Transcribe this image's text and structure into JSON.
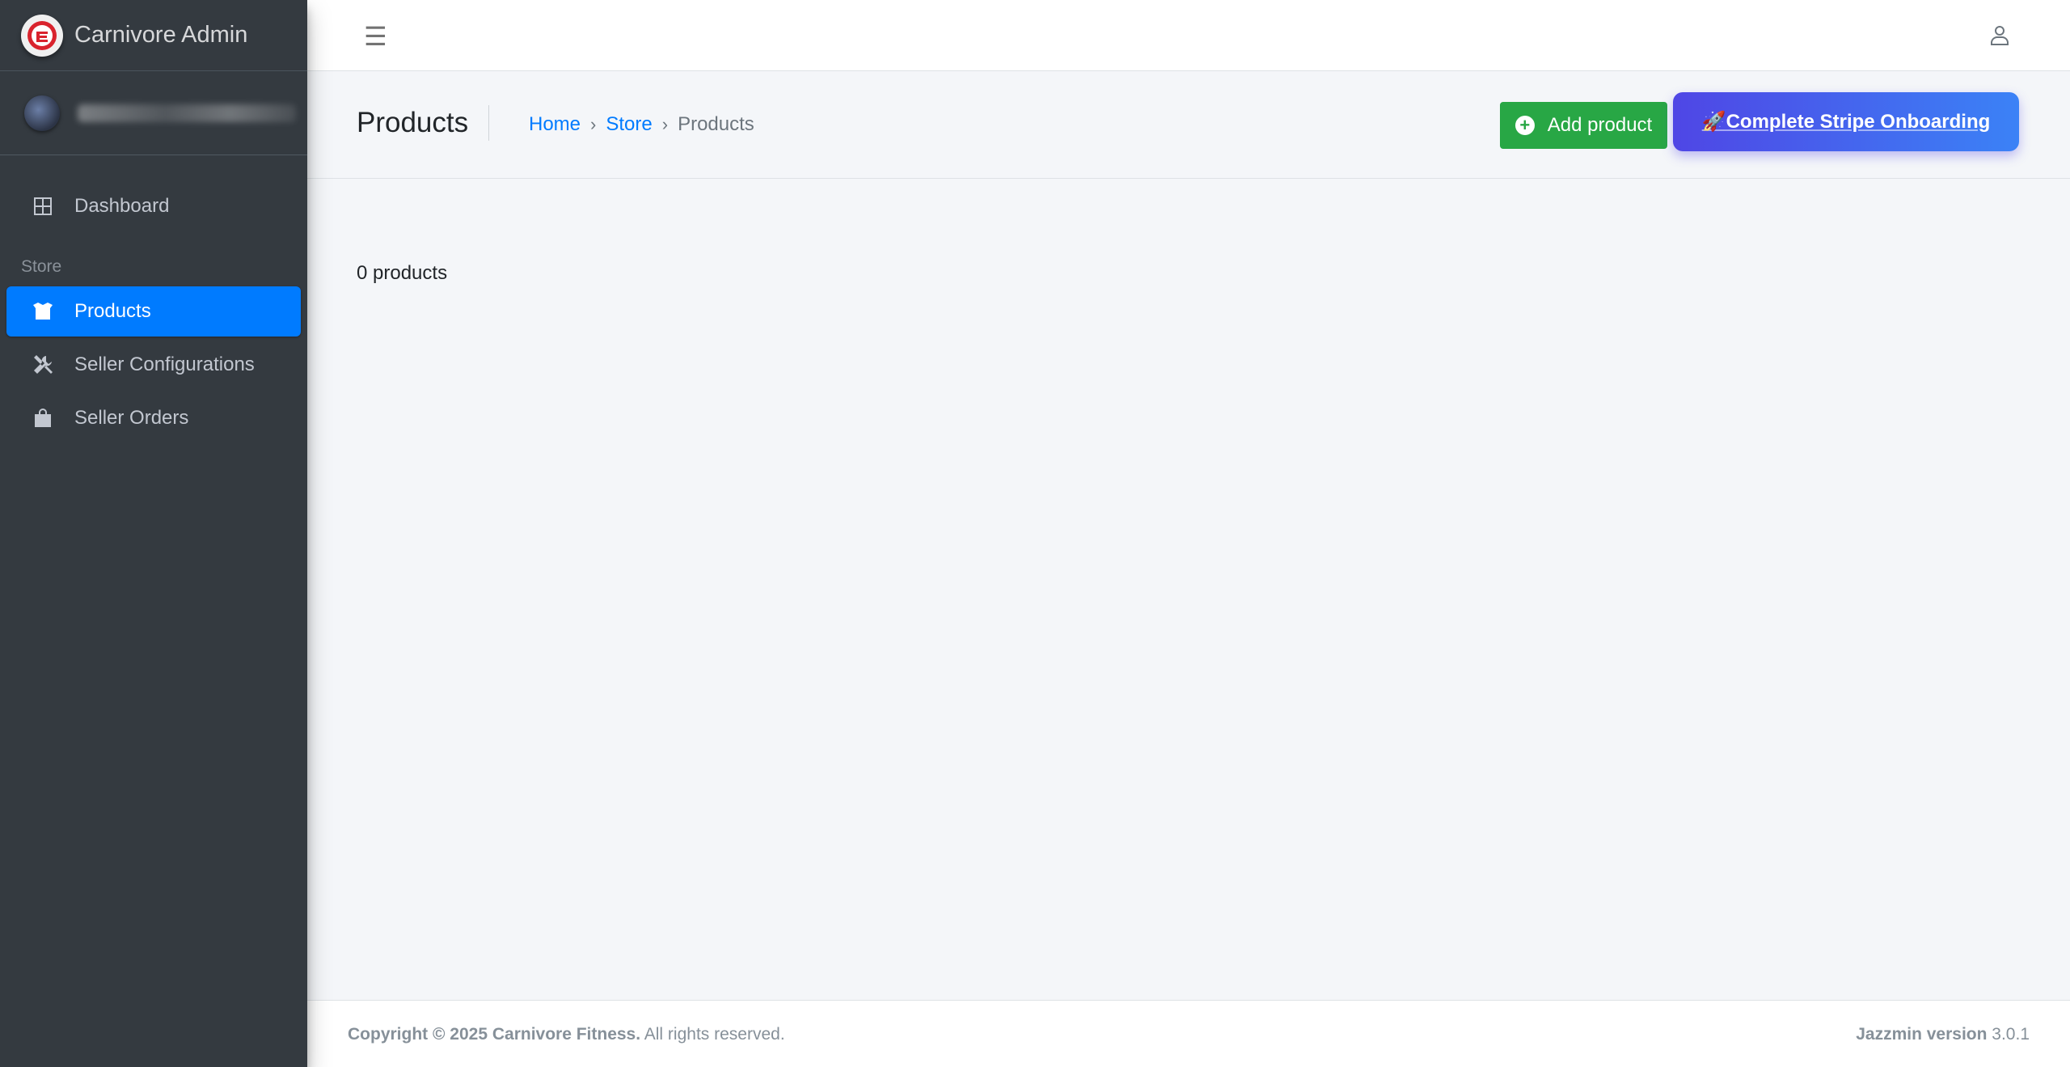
{
  "brand": {
    "title": "Carnivore Admin"
  },
  "sidebar": {
    "dashboard_label": "Dashboard",
    "section_header": "Store",
    "items": [
      {
        "label": "Products"
      },
      {
        "label": "Seller Configurations"
      },
      {
        "label": "Seller Orders"
      }
    ]
  },
  "header": {
    "page_title": "Products",
    "breadcrumb": [
      "Home",
      "Store",
      "Products"
    ],
    "breadcrumb_sep": "›",
    "add_button": "Add product",
    "add_button_icon": "+",
    "stripe_button": "🚀Complete Stripe Onboarding"
  },
  "main": {
    "product_count": "0 products"
  },
  "footer": {
    "copyright_bold": "Copyright © 2025 Carnivore Fitness.",
    "copyright_rest": " All rights reserved.",
    "version_label": "Jazzmin version",
    "version_value": " 3.0.1"
  },
  "colors": {
    "sidebar_bg": "#343a40",
    "active_item": "#007bff",
    "add_button": "#28a745",
    "stripe_gradient_start": "#4f46e5",
    "stripe_gradient_end": "#3b82f6",
    "content_bg": "#f4f6f9"
  },
  "icons": {
    "brand": "carnivore-logo-icon",
    "menu": "hamburger-icon",
    "user": "user-icon",
    "dashboard": "dashboard-grid-icon",
    "products": "box-icon",
    "seller_configurations": "tools-icon",
    "seller_orders": "shopping-bag-icon",
    "add": "plus-circle-icon"
  }
}
